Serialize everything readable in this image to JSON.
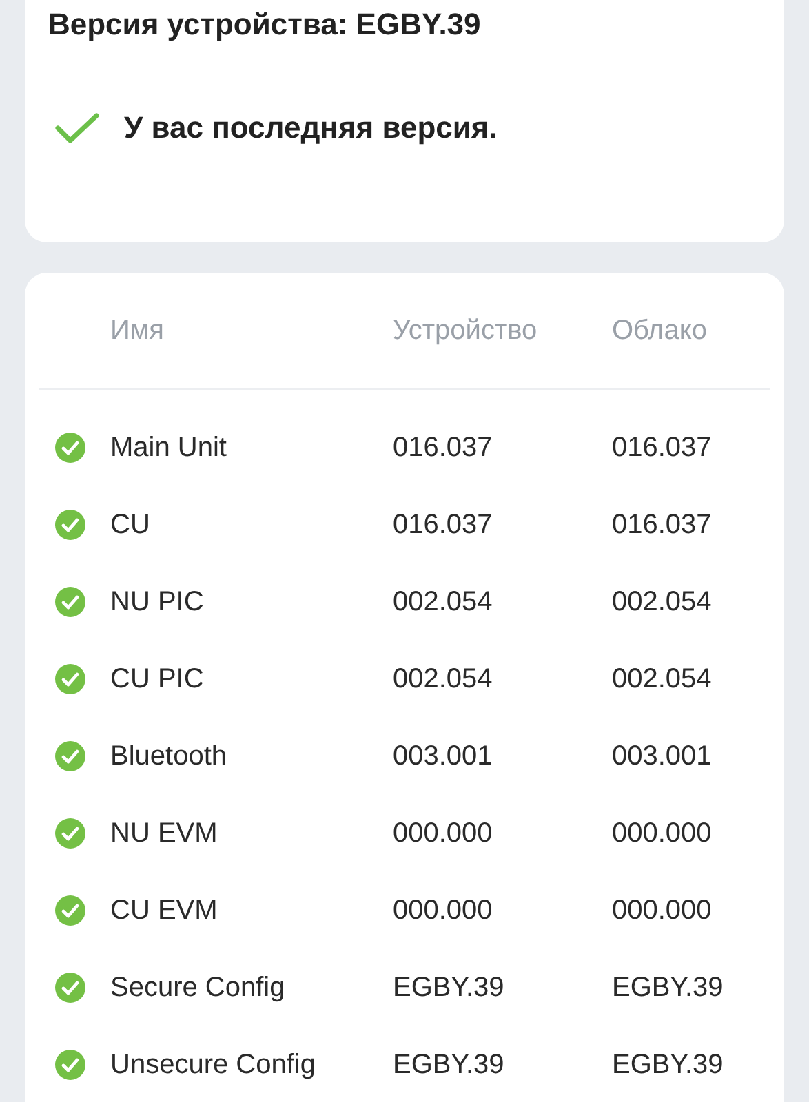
{
  "version_card": {
    "title": "Версия устройства: EGBY.39",
    "status": "У вас последняя версия."
  },
  "table": {
    "columns": [
      "Имя",
      "Устройство",
      "Облако"
    ],
    "rows": [
      {
        "name": "Main Unit",
        "device": "016.037",
        "cloud": "016.037"
      },
      {
        "name": "CU",
        "device": "016.037",
        "cloud": "016.037"
      },
      {
        "name": "NU PIC",
        "device": "002.054",
        "cloud": "002.054"
      },
      {
        "name": "CU PIC",
        "device": "002.054",
        "cloud": "002.054"
      },
      {
        "name": "Bluetooth",
        "device": "003.001",
        "cloud": "003.001"
      },
      {
        "name": "NU EVM",
        "device": "000.000",
        "cloud": "000.000"
      },
      {
        "name": "CU EVM",
        "device": "000.000",
        "cloud": "000.000"
      },
      {
        "name": "Secure Config",
        "device": "EGBY.39",
        "cloud": "EGBY.39"
      },
      {
        "name": "Unsecure Config",
        "device": "EGBY.39",
        "cloud": "EGBY.39"
      }
    ]
  }
}
